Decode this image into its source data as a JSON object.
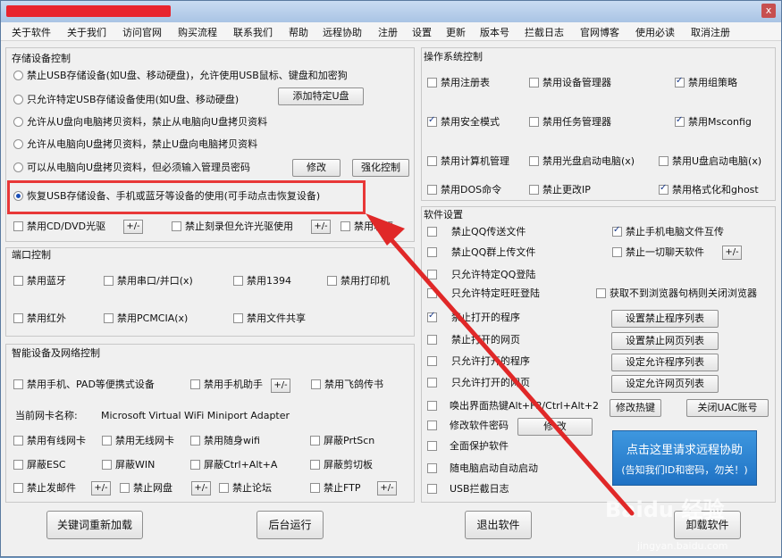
{
  "menu": [
    "关于软件",
    "关于我们",
    "访问官网",
    "购买流程",
    "联系我们",
    "帮助",
    "远程协助",
    "注册",
    "设置",
    "更新",
    "版本号",
    "拦截日志",
    "官网博客",
    "使用必读",
    "取消注册"
  ],
  "storage": {
    "title": "存储设备控制",
    "radios": [
      "禁止USB存储设备(如U盘、移动硬盘)，允许使用USB鼠标、键盘和加密狗",
      "只允许特定USB存储设备使用(如U盘、移动硬盘)",
      "允许从U盘向电脑拷贝资料，禁止从电脑向U盘拷贝资料",
      "允许从电脑向U盘拷贝资料，禁止U盘向电脑拷贝资料",
      "可以从电脑向U盘拷贝资料，但必须输入管理员密码",
      "恢复USB存储设备、手机或蓝牙等设备的使用(可手动点击恢复设备)"
    ],
    "add_device_btn": "添加特定U盘",
    "modify_btn": "修改",
    "enhance_btn": "强化控制",
    "cd_label": "禁用CD/DVD光驱",
    "burn_label": "禁止刻录但允许光驱使用",
    "floppy_label": "禁用软驱",
    "pm": "+/-"
  },
  "port": {
    "title": "端口控制",
    "items": [
      "禁用蓝牙",
      "禁用串口/并口(x)",
      "禁用1394",
      "禁用打印机",
      "禁用红外",
      "禁用PCMCIA(x)",
      "禁用文件共享"
    ]
  },
  "smart": {
    "title": "智能设备及网络控制",
    "items": [
      "禁用手机、PAD等便携式设备",
      "禁用手机助手",
      "禁用飞鸽传书"
    ],
    "nic_label": "当前网卡名称:",
    "nic_value": "Microsoft Virtual WiFi Miniport Adapter",
    "net": [
      "禁用有线网卡",
      "禁用无线网卡",
      "禁用随身wifi",
      "屏蔽PrtScn",
      "屏蔽ESC",
      "屏蔽WIN",
      "屏蔽Ctrl+Alt+A",
      "屏蔽剪切板",
      "禁止发邮件",
      "禁止网盘",
      "禁止论坛",
      "禁止FTP"
    ]
  },
  "os": {
    "title": "操作系统控制",
    "items": [
      "禁用注册表",
      "禁用设备管理器",
      "禁用组策略",
      "禁用安全模式",
      "禁用任务管理器",
      "禁用Msconfig",
      "禁用计算机管理",
      "禁用光盘启动电脑(x)",
      "禁用U盘启动电脑(x)",
      "禁用DOS命令",
      "禁止更改IP",
      "禁用格式化和ghost"
    ]
  },
  "software": {
    "title": "软件设置",
    "items": [
      "禁止QQ传送文件",
      "禁止手机电脑文件互传",
      "禁止QQ群上传文件",
      "禁止一切聊天软件",
      "只允许特定QQ登陆",
      "只允许特定旺旺登陆",
      "获取不到浏览器句柄则关闭浏览器",
      "禁止打开的程序",
      "禁止打开的网页",
      "只允许打开的程序",
      "只允许打开的网页",
      "唤出界面热键Alt+F2/Ctrl+Alt+2",
      "修改软件密码",
      "全面保护软件",
      "随电脑启动自动启动",
      "USB拦截日志"
    ],
    "buttons": [
      "设置禁止程序列表",
      "设置禁止网页列表",
      "设定允许程序列表",
      "设定允许网页列表",
      "修改热键",
      "关闭UAC账号",
      "修 改"
    ]
  },
  "remote": {
    "line1": "点击这里请求远程协助",
    "line2": "(告知我们ID和密码，勿关！)"
  },
  "bottom": [
    "关键词重新加载",
    "后台运行",
    "退出软件",
    "卸载软件"
  ],
  "watermark": {
    "text": "Baidu 经验",
    "url": "jingyan.baidu.com"
  },
  "title_close": "x"
}
